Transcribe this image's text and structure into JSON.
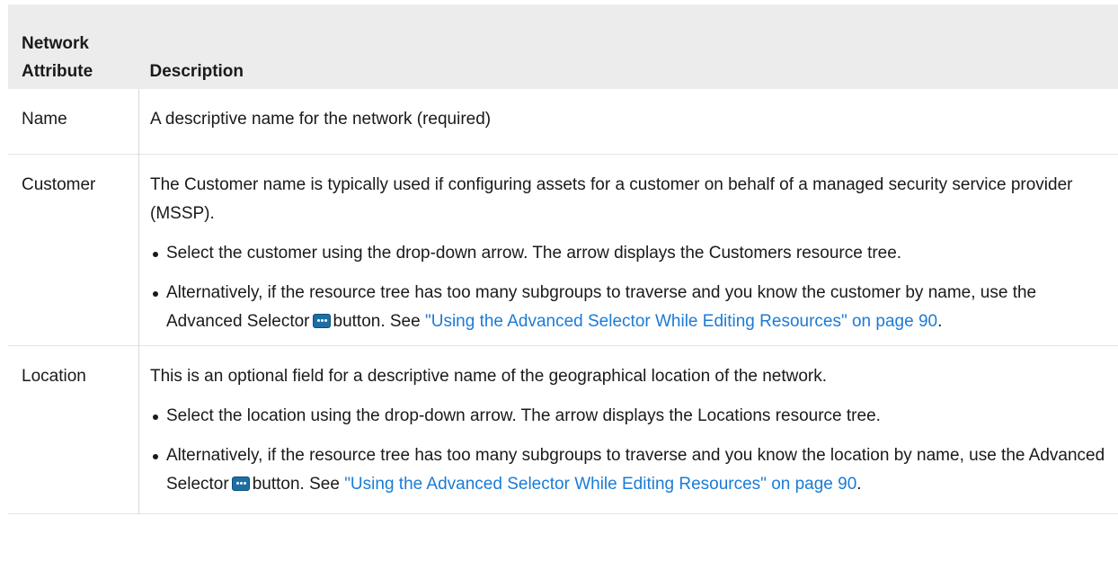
{
  "table": {
    "header": {
      "attribute_line1": "Network",
      "attribute_line2": "Attribute",
      "description": "Description"
    },
    "rows": [
      {
        "attribute": "Name",
        "description": "A descriptive name for the network (required)"
      },
      {
        "attribute": "Customer",
        "description": "The Customer name is typically used if configuring assets for a customer on behalf of a managed security service provider (MSSP).",
        "bullets": [
          {
            "text": "Select the customer using the drop-down arrow. The arrow displays the Customers resource tree."
          },
          {
            "pre": "Alternatively, if the resource tree has too many subgroups to traverse and you know the customer by name, use the Advanced Selector",
            "icon": "advanced-selector-icon",
            "post": "button. See",
            "link": "\"Using the Advanced Selector While Editing Resources\" on page 90",
            "end": "."
          }
        ]
      },
      {
        "attribute": "Location",
        "description": "This is an optional field for a descriptive name of the geographical location of the network.",
        "bullets": [
          {
            "text": "Select the location using the drop-down arrow. The arrow displays the Locations resource tree."
          },
          {
            "pre": "Alternatively, if the resource tree has too many subgroups to traverse and you know the location by name, use the Advanced Selector",
            "icon": "advanced-selector-icon",
            "post": "button. See",
            "link": "\"Using the Advanced Selector While Editing Resources\" on page 90",
            "end": "."
          }
        ]
      }
    ]
  },
  "colors": {
    "header_bg": "#ececec",
    "link": "#1b7bd6",
    "icon": "#1d6fa3"
  }
}
